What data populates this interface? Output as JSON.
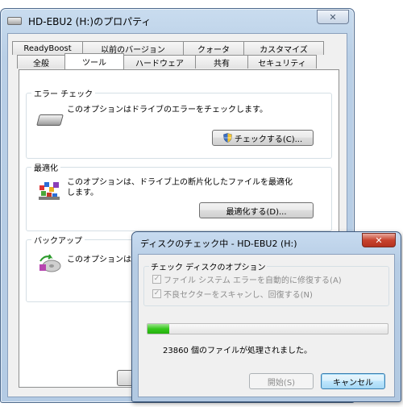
{
  "main_window": {
    "title": "HD-EBU2 (H:)のプロパティ",
    "close_glyph": "✕",
    "tabs_row1": [
      "ReadyBoost",
      "以前のバージョン",
      "クォータ",
      "カスタマイズ"
    ],
    "tabs_row2": [
      "全般",
      "ツール",
      "ハードウェア",
      "共有",
      "セキュリティ"
    ],
    "active_tab": "ツール",
    "error_check": {
      "title": "エラー チェック",
      "description": "このオプションはドライブのエラーをチェックします。",
      "button": "チェックする(C)..."
    },
    "optimize": {
      "title": "最適化",
      "description": "このオプションは、ドライブ上の断片化したファイルを最適化します。",
      "button": "最適化する(D)..."
    },
    "backup": {
      "title": "バックアップ",
      "description": "このオプションは"
    }
  },
  "check_dialog": {
    "title": "ディスクのチェック中 - HD-EBU2 (H:)",
    "close_glyph": "✕",
    "options_title": "チェック ディスクのオプション",
    "options": [
      {
        "label": "ファイル システム エラーを自動的に修復する(A)",
        "checked": true
      },
      {
        "label": "不良セクターをスキャンし、回復する(N)",
        "checked": true
      }
    ],
    "progress_fraction": 0.09,
    "status": "23860 個のファイルが処理されました。",
    "start_button": "開始(S)",
    "cancel_button": "キャンセル"
  },
  "colors": {
    "window_frame": "#b9cfe6",
    "close_red": "#c8432e",
    "progress_green": "#35c81c"
  }
}
